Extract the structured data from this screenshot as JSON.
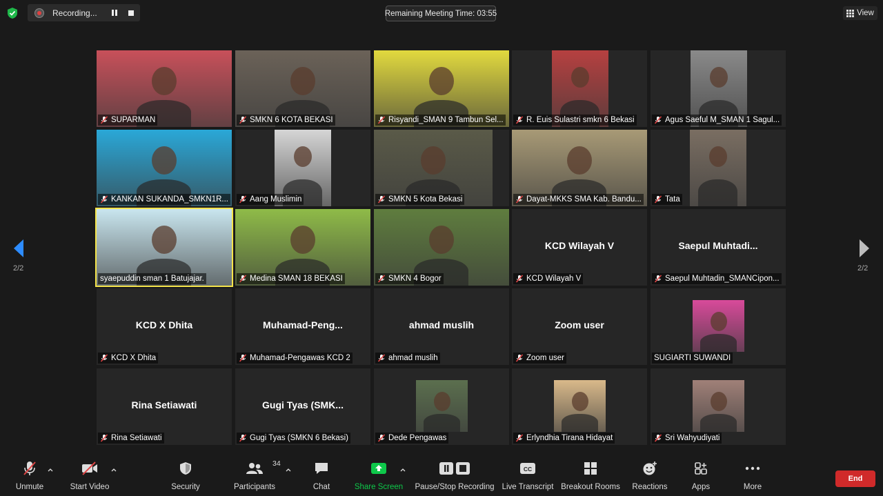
{
  "topbar": {
    "recording_label": "Recording...",
    "timer_text": "Remaining Meeting Time: 03:55",
    "view_label": "View"
  },
  "pagination": {
    "left": "2/2",
    "right": "2/2"
  },
  "participants": [
    {
      "name": "SUPARMAN",
      "display": "",
      "bg": "#c8505a"
    },
    {
      "name": "SMKN 6 KOTA BEKASI",
      "display": "",
      "bg": "#6b6258"
    },
    {
      "name": "Risyandi_SMAN 9 Tambun Sel...",
      "display": "",
      "bg": "#e2da3e"
    },
    {
      "name": "R. Euis Sulastri smkn 6 Bekasi",
      "display": "",
      "bg": "#b64040"
    },
    {
      "name": "Agus Saeful M_SMAN 1 Sagul...",
      "display": "",
      "bg": "#8a8a8a"
    },
    {
      "name": "KANKAN SUKANDA_SMKN1R...",
      "display": "",
      "bg": "#2aa8d8"
    },
    {
      "name": "Aang Muslimin",
      "display": "",
      "bg": "#d6d6d6"
    },
    {
      "name": "SMKN 5 Kota Bekasi",
      "display": "",
      "bg": "#5a5a48"
    },
    {
      "name": "Dayat-MKKS SMA Kab. Bandu...",
      "display": "",
      "bg": "#a89a76"
    },
    {
      "name": "Tata",
      "display": "",
      "bg": "#7a6e62"
    },
    {
      "name": "syaepuddin sman 1 Batujajar.",
      "display": "",
      "bg": "#c9e6ef"
    },
    {
      "name": "Medina SMAN 18 BEKASI",
      "display": "",
      "bg": "#8fbb48"
    },
    {
      "name": "SMKN 4 Bogor",
      "display": "",
      "bg": "#5f7d3e"
    },
    {
      "name": "KCD Wilayah V",
      "display": "KCD Wilayah V",
      "bg": ""
    },
    {
      "name": "Saepul Muhtadin_SMANCipon...",
      "display": "Saepul  Muhtadi...",
      "bg": ""
    },
    {
      "name": "KCD X Dhita",
      "display": "KCD X Dhita",
      "bg": ""
    },
    {
      "name": "Muhamad-Pengawas KCD 2",
      "display": "Muhamad-Peng...",
      "bg": ""
    },
    {
      "name": "ahmad muslih",
      "display": "ahmad muslih",
      "bg": ""
    },
    {
      "name": "Zoom user",
      "display": "Zoom user",
      "bg": ""
    },
    {
      "name": "SUGIARTI SUWANDI",
      "display": "",
      "bg": "#d84a9a"
    },
    {
      "name": "Rina Setiawati",
      "display": "Rina Setiawati",
      "bg": ""
    },
    {
      "name": "Gugi Tyas (SMKN 6 Bekasi)",
      "display": "Gugi  Tyas  (SMK...",
      "bg": ""
    },
    {
      "name": "Dede Pengawas",
      "display": "",
      "bg": "#5b6f4e"
    },
    {
      "name": "Erlyndhia Tirana Hidayat",
      "display": "",
      "bg": "#d9b98a"
    },
    {
      "name": "Sri Wahyudiyati",
      "display": "",
      "bg": "#a08078"
    }
  ],
  "toolbar": {
    "unmute": "Unmute",
    "start_video": "Start Video",
    "security": "Security",
    "participants": "Participants",
    "participant_count": "34",
    "chat": "Chat",
    "share_screen": "Share Screen",
    "recording": "Pause/Stop Recording",
    "transcript": "Live Transcript",
    "cc": "CC",
    "breakout": "Breakout Rooms",
    "reactions": "Reactions",
    "apps": "Apps",
    "more": "More",
    "end": "End"
  },
  "colors": {
    "share_green": "#0ec84a",
    "end_red": "#d02a2a",
    "mute_red": "#e04545",
    "active_border": "#f5e44a"
  }
}
